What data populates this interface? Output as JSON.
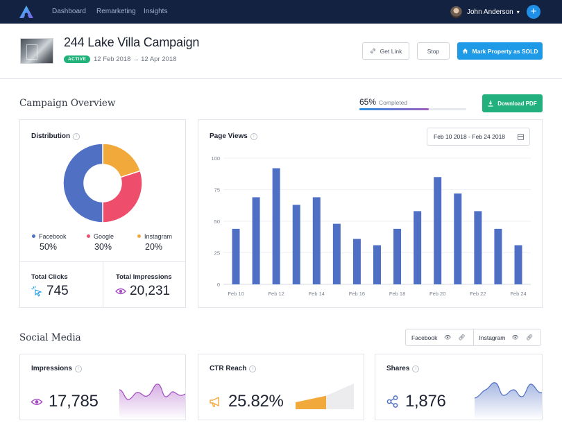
{
  "nav": {
    "links": [
      "Dashboard",
      "Remarketing",
      "Insights"
    ],
    "user_name": "John Anderson"
  },
  "header": {
    "title": "244 Lake Villa Campaign",
    "status": "ACTIVE",
    "start_date": "12 Feb 2018",
    "end_date": "12 Apr 2018",
    "get_link_label": "Get Link",
    "stop_label": "Stop",
    "mark_sold_label": "Mark Property as SOLD"
  },
  "overview": {
    "title": "Campaign Overview",
    "progress_value": "65%",
    "progress_fraction": 0.65,
    "progress_label": "Completed",
    "download_label": "Download PDF"
  },
  "distribution": {
    "title": "Distribution",
    "items": [
      {
        "label": "Facebook",
        "pct": "50%",
        "value": 50,
        "color": "#5070c4"
      },
      {
        "label": "Google",
        "pct": "30%",
        "value": 30,
        "color": "#ee4d6c"
      },
      {
        "label": "Instagram",
        "pct": "20%",
        "value": 20,
        "color": "#f2a93b"
      }
    ],
    "total_clicks_label": "Total Clicks",
    "total_clicks": "745",
    "total_impressions_label": "Total Impressions",
    "total_impressions": "20,231"
  },
  "page_views": {
    "title": "Page Views",
    "date_range": "Feb 10 2018 - Feb 24 2018"
  },
  "chart_data": {
    "type": "bar",
    "ylim": [
      0,
      100
    ],
    "yticks": [
      0,
      25,
      50,
      75,
      100
    ],
    "xtick_labels": [
      "Feb 10",
      "Feb 12",
      "Feb 14",
      "Feb 16",
      "Feb 18",
      "Feb 20",
      "Feb 22",
      "Feb 24"
    ],
    "values": [
      44,
      69,
      92,
      63,
      69,
      48,
      36,
      31,
      44,
      58,
      85,
      72,
      58,
      44,
      31
    ],
    "color": "#4e6fc4"
  },
  "social": {
    "title": "Social Media",
    "toggles": [
      "Facebook",
      "Instagram"
    ],
    "cards": [
      {
        "title": "Impressions",
        "value": "17,785"
      },
      {
        "title": "CTR Reach",
        "value": "25.82%"
      },
      {
        "title": "Shares",
        "value": "1,876"
      }
    ]
  }
}
